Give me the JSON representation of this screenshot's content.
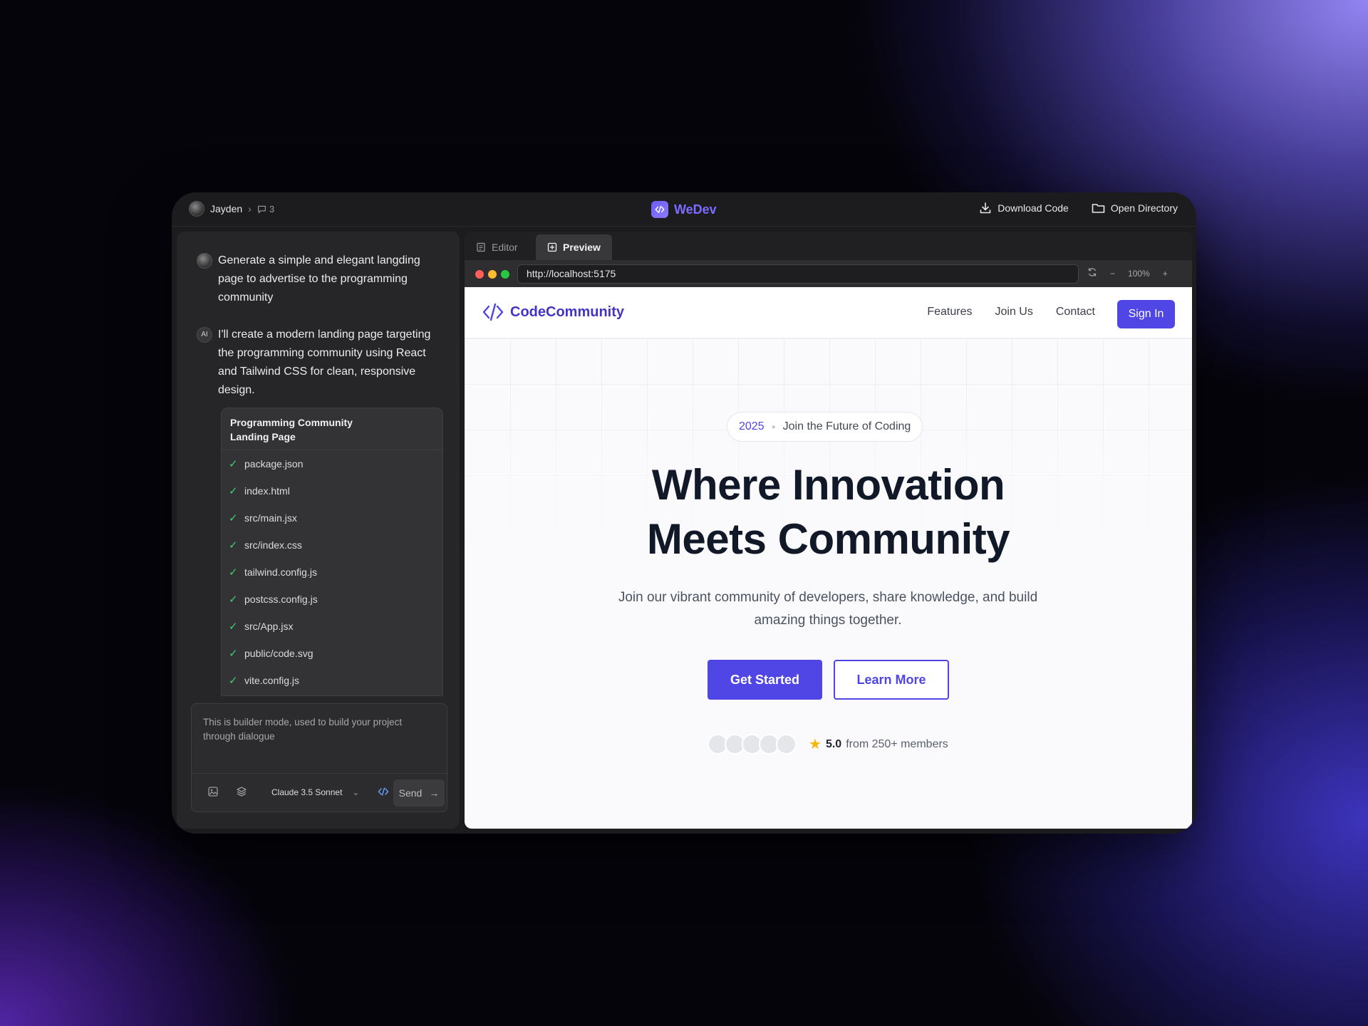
{
  "topbar": {
    "user_name": "Jayden",
    "message_count": "3",
    "app_name": "WeDev",
    "download_label": "Download Code",
    "open_dir_label": "Open Directory"
  },
  "chat": {
    "user_message": "Generate a simple and elegant langding page to advertise to the programming community",
    "ai_badge": "AI",
    "ai_message": "I'll create a modern landing page targeting the programming community using React and Tailwind CSS for clean, responsive design.",
    "artifact": {
      "title_line1": "Programming Community",
      "title_line2": "Landing Page",
      "files": [
        "package.json",
        "index.html",
        "src/main.jsx",
        "src/index.css",
        "tailwind.config.js",
        "postcss.config.js",
        "src/App.jsx",
        "public/code.svg",
        "vite.config.js"
      ]
    },
    "composer": {
      "placeholder": "This is builder mode, used to build your project through dialogue",
      "model": "Claude 3.5 Sonnet",
      "send_label": "Send"
    }
  },
  "preview": {
    "tabs": [
      "Editor",
      "Preview"
    ],
    "active_tab": "Preview",
    "url": "http://localhost:5175",
    "zoom": "100%",
    "site": {
      "brand": "CodeCommunity",
      "nav_links": [
        "Features",
        "Join Us",
        "Contact"
      ],
      "signin": "Sign In",
      "pill_year": "2025",
      "pill_text": "Join the Future of Coding",
      "title_line1": "Where Innovation",
      "title_line2": "Meets Community",
      "subtitle": "Join our vibrant community of developers, share knowledge, and build amazing things together.",
      "primary_cta": "Get Started",
      "secondary_cta": "Learn More",
      "rating_score": "5.0",
      "rating_text": "from 250+ members"
    }
  },
  "colors": {
    "accent": "#4f46e5",
    "brand_purple": "#7b6cff",
    "check_green": "#3ecf6e",
    "star": "#f5b800"
  }
}
